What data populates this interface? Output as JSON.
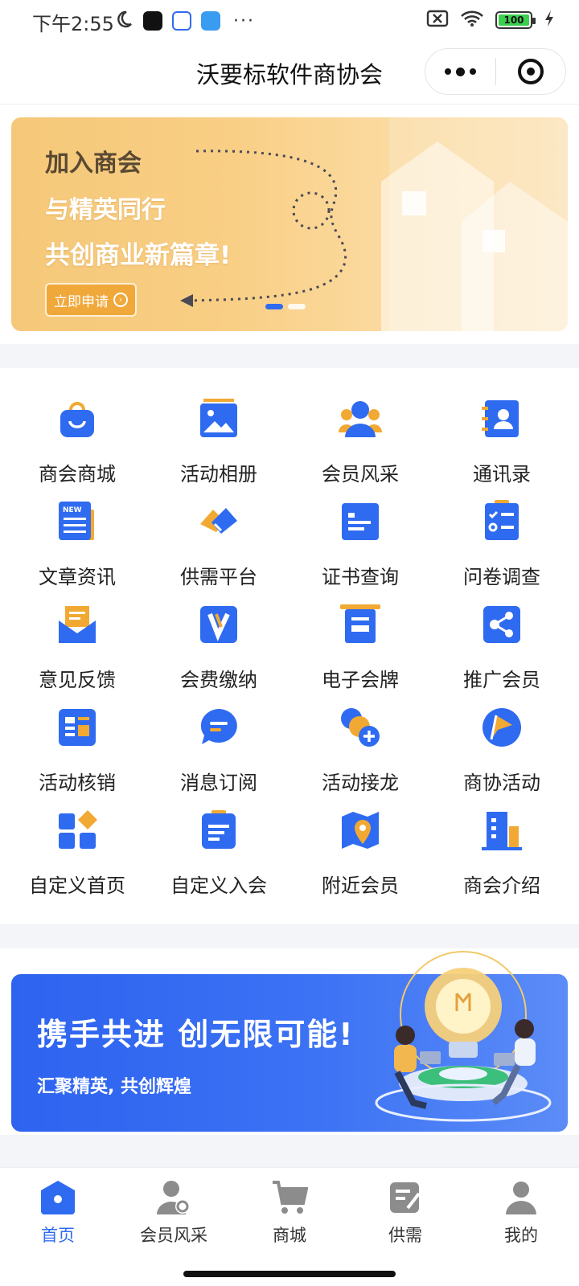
{
  "status_bar": {
    "time": "下午2:55",
    "more": "···",
    "battery": "100"
  },
  "title_bar": {
    "title": "沃要标软件商协会"
  },
  "banner": {
    "line1": "加入商会",
    "line2": "与精英同行",
    "line3": "共创商业新篇章!",
    "button": "立即申请",
    "colors": {
      "background": "#f8cd85",
      "button": "#f0a83a"
    }
  },
  "menu": {
    "items": [
      {
        "label": "商会商城",
        "icon": "shopping-bag-icon"
      },
      {
        "label": "活动相册",
        "icon": "photo-album-icon"
      },
      {
        "label": "会员风采",
        "icon": "members-icon"
      },
      {
        "label": "通讯录",
        "icon": "contacts-book-icon"
      },
      {
        "label": "文章资讯",
        "icon": "news-icon"
      },
      {
        "label": "供需平台",
        "icon": "handshake-icon"
      },
      {
        "label": "证书查询",
        "icon": "certificate-icon"
      },
      {
        "label": "问卷调查",
        "icon": "survey-checklist-icon"
      },
      {
        "label": "意见反馈",
        "icon": "feedback-mail-icon"
      },
      {
        "label": "会费缴纳",
        "icon": "fee-v-icon"
      },
      {
        "label": "电子会牌",
        "icon": "e-plaque-icon"
      },
      {
        "label": "推广会员",
        "icon": "share-icon"
      },
      {
        "label": "活动核销",
        "icon": "verify-card-icon"
      },
      {
        "label": "消息订阅",
        "icon": "message-bubble-icon"
      },
      {
        "label": "活动接龙",
        "icon": "add-chain-icon"
      },
      {
        "label": "商协活动",
        "icon": "flag-icon"
      },
      {
        "label": "自定义首页",
        "icon": "custom-grid-icon"
      },
      {
        "label": "自定义入会",
        "icon": "clipboard-icon"
      },
      {
        "label": "附近会员",
        "icon": "map-pin-icon"
      },
      {
        "label": "商会介绍",
        "icon": "building-icon"
      }
    ]
  },
  "promo": {
    "title": "携手共进  创无限可能!",
    "subtitle": "汇聚精英, 共创辉煌",
    "colors": {
      "background": "#2f6bf0"
    }
  },
  "tabbar": {
    "tabs": [
      {
        "label": "首页",
        "icon": "home-icon",
        "active": true
      },
      {
        "label": "会员风采",
        "icon": "member-icon",
        "active": false
      },
      {
        "label": "商城",
        "icon": "cart-icon",
        "active": false
      },
      {
        "label": "供需",
        "icon": "supply-demand-icon",
        "active": false
      },
      {
        "label": "我的",
        "icon": "profile-icon",
        "active": false
      }
    ],
    "colors": {
      "active": "#2f6bf0",
      "inactive": "#8c8c8c"
    }
  }
}
